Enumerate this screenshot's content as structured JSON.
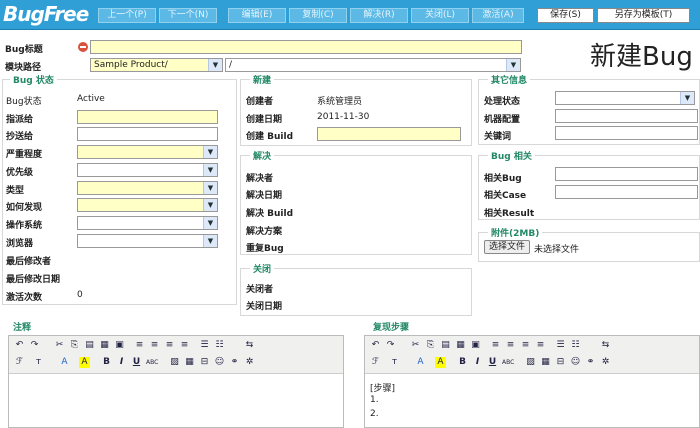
{
  "app": {
    "logo": "BugFree"
  },
  "toolbar": {
    "prev": "上一个(P)",
    "next": "下一个(N)",
    "edit": "编辑(E)",
    "copy": "复制(C)",
    "resolve": "解决(R)",
    "close": "关闭(L)",
    "activate": "激活(A)",
    "save": "保存(S)",
    "save_template": "另存为模板(T)"
  },
  "header": {
    "bug_title_label": "Bug标题",
    "bug_title_value": "",
    "module_label": "模块路径",
    "product_value": "Sample Product/",
    "module_value": "/",
    "page_title": "新建Bug"
  },
  "bug_status": {
    "title": "Bug 状态",
    "rows": [
      {
        "label": "Bug状态",
        "value": "Active"
      },
      {
        "label": "指派给",
        "value": ""
      },
      {
        "label": "抄送给",
        "value": ""
      },
      {
        "label": "严重程度",
        "value": ""
      },
      {
        "label": "优先级",
        "value": ""
      },
      {
        "label": "类型",
        "value": ""
      },
      {
        "label": "如何发现",
        "value": ""
      },
      {
        "label": "操作系统",
        "value": ""
      },
      {
        "label": "浏览器",
        "value": ""
      },
      {
        "label": "最后修改者",
        "value": ""
      },
      {
        "label": "最后修改日期",
        "value": ""
      },
      {
        "label": "激活次数",
        "value": "0"
      }
    ]
  },
  "created": {
    "title": "新建",
    "creator_label": "创建者",
    "creator_value": "系统管理员",
    "date_label": "创建日期",
    "date_value": "2011-11-30",
    "build_label": "创建 Build",
    "build_value": ""
  },
  "resolved": {
    "title": "解决",
    "rows": [
      "解决者",
      "解决日期",
      "解决 Build",
      "解决方案",
      "重复Bug"
    ]
  },
  "closed": {
    "title": "关闭",
    "rows": [
      "关闭者",
      "关闭日期"
    ]
  },
  "other": {
    "title": "其它信息",
    "rows": [
      {
        "label": "处理状态",
        "value": ""
      },
      {
        "label": "机器配置",
        "value": ""
      },
      {
        "label": "关键词",
        "value": ""
      }
    ]
  },
  "bug_related": {
    "title": "Bug 相关",
    "rows": [
      {
        "label": "相关Bug",
        "value": ""
      },
      {
        "label": "相关Case",
        "value": ""
      },
      {
        "label": "相关Result",
        "value": ""
      }
    ]
  },
  "attachment": {
    "title": "附件(2MB)",
    "choose_label": "选择文件",
    "no_file": "未选择文件"
  },
  "notes": {
    "title": "注释"
  },
  "repro": {
    "title": "复现步骤",
    "lines": [
      "[步骤]",
      "1.",
      "2."
    ]
  },
  "colors": {
    "topbar": "#2f9fd6",
    "required_field": "#ffffc6",
    "group_title": "#228866"
  }
}
